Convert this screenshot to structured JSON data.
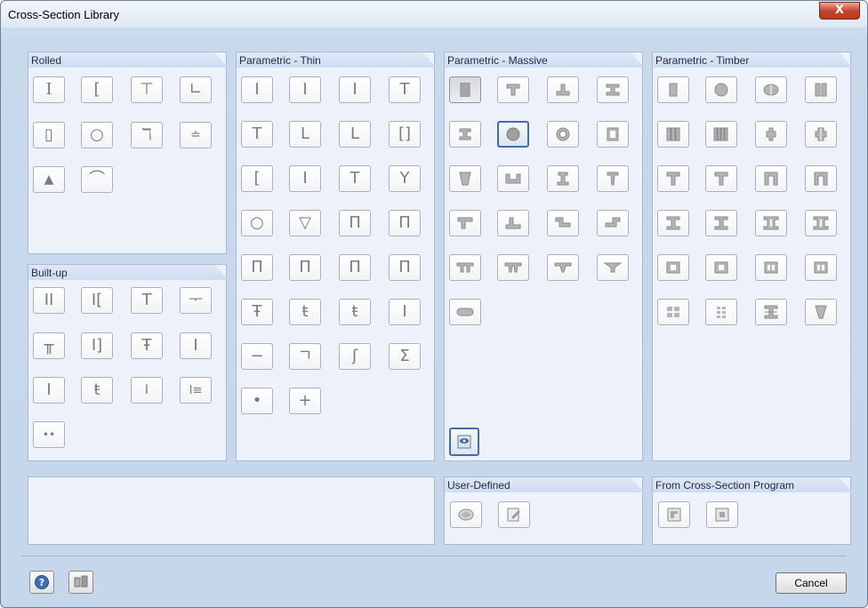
{
  "window": {
    "title": "Cross-Section Library",
    "close_label": "X"
  },
  "groups": {
    "rolled": {
      "label": "Rolled",
      "icons": [
        "I",
        "[",
        "T",
        "L",
        "0",
        "○",
        "ㄱ",
        "±",
        "▲",
        "∩"
      ]
    },
    "parametric_thin": {
      "label": "Parametric - Thin"
    },
    "parametric_massive": {
      "label": "Parametric - Massive"
    },
    "parametric_timber": {
      "label": "Parametric - Timber"
    },
    "built_up": {
      "label": "Built-up"
    },
    "user_defined": {
      "label": "User-Defined"
    },
    "from_program": {
      "label": "From Cross-Section Program"
    }
  },
  "thin_icons": [
    "I",
    "I",
    "I",
    "T",
    "T",
    "L",
    "L",
    "[]",
    "[",
    "I",
    "T",
    "Y",
    "○",
    "▽",
    "Π",
    "Π",
    "Π",
    "Π",
    "Π",
    "Π",
    "Ŧ",
    "ŧ",
    "ŧ",
    "I",
    "−",
    "ㄱ",
    "ʃ",
    "Σ",
    "•",
    "+"
  ],
  "builtup_icons": [
    "II",
    "I[",
    "T",
    "ᅮ",
    "╥",
    "I]",
    "Ŧ",
    "I",
    "I",
    "ŧ",
    "I",
    "I≡",
    "••"
  ],
  "footer": {
    "cancel_label": "Cancel",
    "help_icon": "help-icon",
    "units_icon": "units-icon"
  }
}
